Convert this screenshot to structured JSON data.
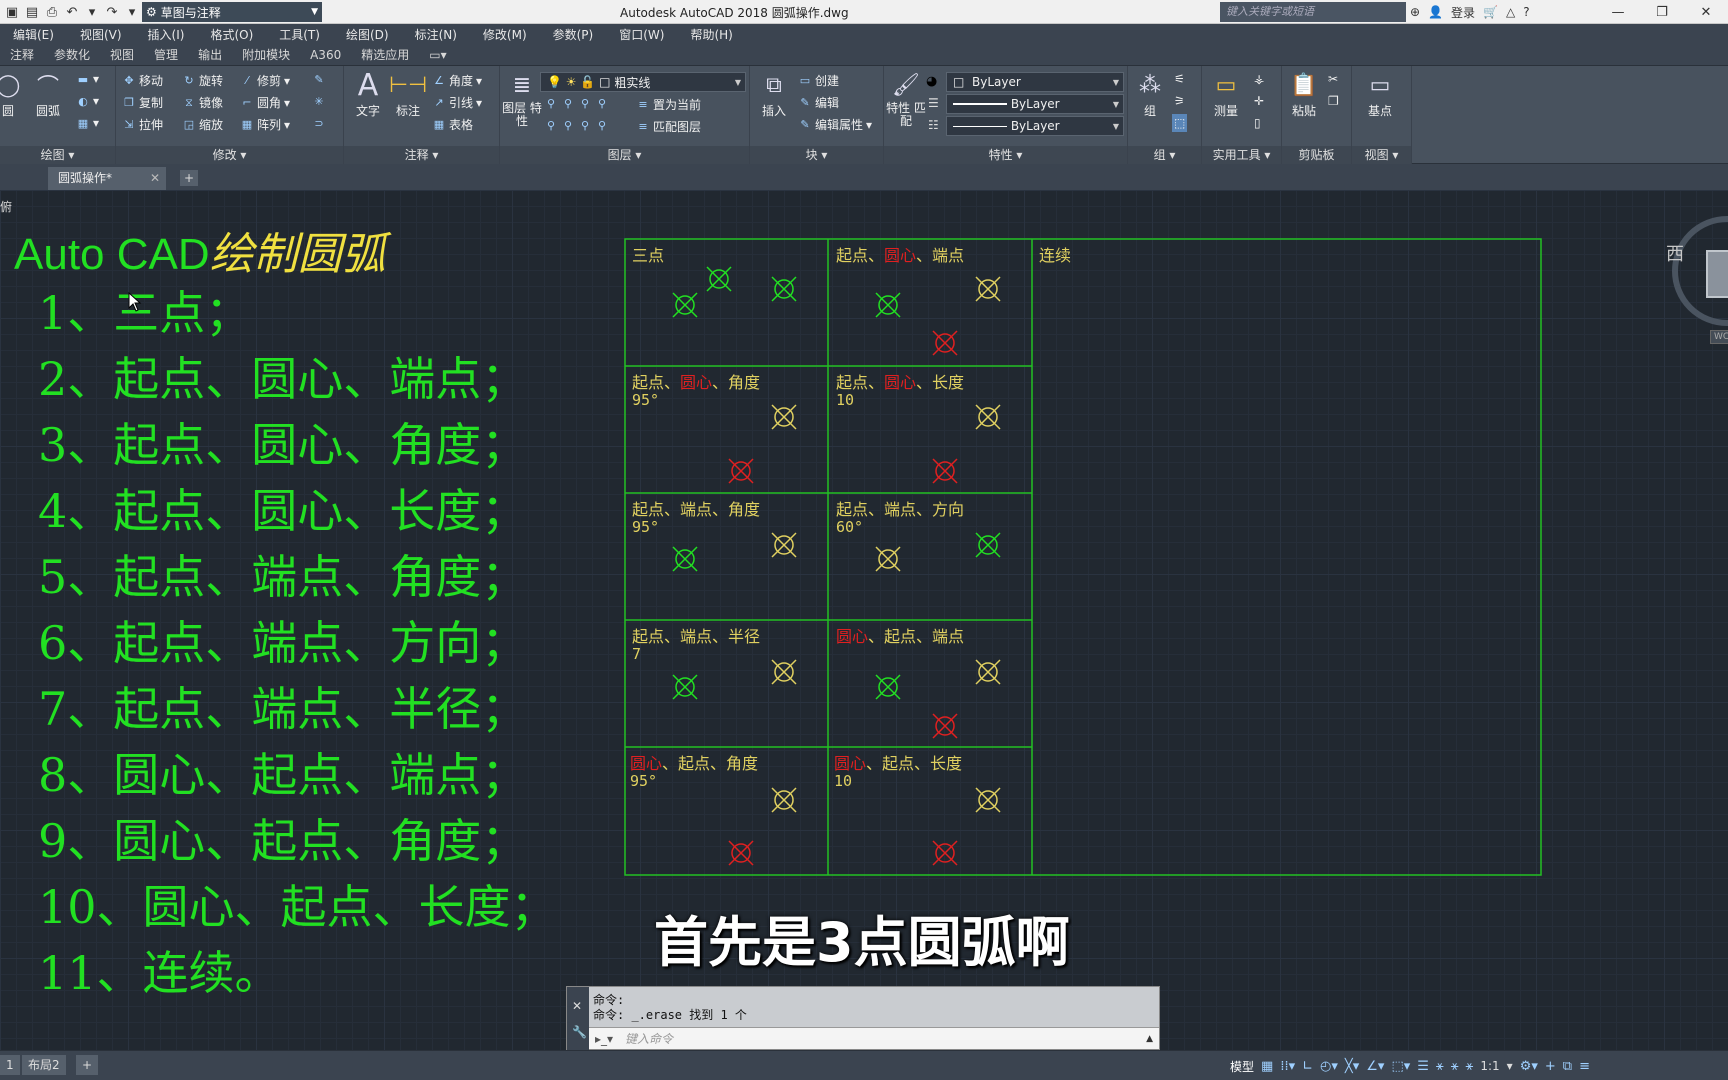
{
  "titlebar": {
    "workspace": "草图与注释",
    "title": "Autodesk AutoCAD 2018    圆弧操作.dwg",
    "search_placeholder": "键入关键字或短语",
    "login": "登录"
  },
  "menu": [
    "编辑(E)",
    "视图(V)",
    "插入(I)",
    "格式(O)",
    "工具(T)",
    "绘图(D)",
    "标注(N)",
    "修改(M)",
    "参数(P)",
    "窗口(W)",
    "帮助(H)"
  ],
  "ribbon_tabs": [
    "注释",
    "参数化",
    "视图",
    "管理",
    "输出",
    "附加模块",
    "A360",
    "精选应用"
  ],
  "ribbon": {
    "draw": {
      "arc": "圆弧",
      "circle": "圆",
      "title": "绘图"
    },
    "modify": {
      "move": "移动",
      "rotate": "旋转",
      "trim": "修剪",
      "copy": "复制",
      "mirror": "镜像",
      "fillet": "圆角",
      "stretch": "拉伸",
      "scale": "缩放",
      "array": "阵列",
      "title": "修改"
    },
    "annotation": {
      "text": "文字",
      "dim": "标注",
      "angle": "角度",
      "leader": "引线",
      "table": "表格",
      "title": "注释"
    },
    "layers": {
      "layer_props": "图层\n特性",
      "current_layer": "粗实线",
      "make_current": "置为当前",
      "match_layer": "匹配图层",
      "title": "图层"
    },
    "block": {
      "insert": "插入",
      "create": "创建",
      "edit": "编辑",
      "edit_attr": "编辑属性",
      "title": "块"
    },
    "properties": {
      "match": "特性\n匹配",
      "color": "ByLayer",
      "linetype": "ByLayer",
      "lineweight": "ByLayer",
      "title": "特性"
    },
    "groups": {
      "group": "组",
      "title": "组"
    },
    "utilities": {
      "measure": "测量",
      "title": "实用工具"
    },
    "clipboard": {
      "paste": "粘贴",
      "title": "剪贴板"
    },
    "view": {
      "base": "基点",
      "title": "视图"
    }
  },
  "doc_tab": "圆弧操作*",
  "viewport_label": "俯",
  "heading": {
    "white": "Auto CAD",
    "yellow": "绘制圆弧"
  },
  "steps": [
    "1、三点；",
    "2、起点、圆心、端点；",
    "3、起点、圆心、角度；",
    "4、起点、圆心、长度；",
    "5、起点、端点、角度；",
    "6、起点、端点、方向；",
    "7、起点、端点、半径；",
    "8、圆心、起点、端点；",
    "9、圆心、起点、角度；",
    "10、圆心、起点、长度；",
    "11、连续。"
  ],
  "cells": [
    {
      "parts": [
        [
          "三点",
          "y"
        ]
      ],
      "value": ""
    },
    {
      "parts": [
        [
          "起点、",
          "y"
        ],
        [
          "圆心",
          "r"
        ],
        [
          "、端点",
          "y"
        ]
      ],
      "value": ""
    },
    {
      "parts": [
        [
          "连续",
          "y"
        ]
      ],
      "value": ""
    },
    {
      "parts": [
        [
          "起点、",
          "y"
        ],
        [
          "圆心",
          "r"
        ],
        [
          "、角度",
          "y"
        ]
      ],
      "value": "95°"
    },
    {
      "parts": [
        [
          "起点、",
          "y"
        ],
        [
          "圆心",
          "r"
        ],
        [
          "、长度",
          "y"
        ]
      ],
      "value": "10"
    },
    {
      "parts": [
        [
          "起点、端点、角度",
          "y"
        ]
      ],
      "value": "95°"
    },
    {
      "parts": [
        [
          "起点、端点、方向",
          "y"
        ]
      ],
      "value": "60°"
    },
    {
      "parts": [
        [
          "起点、端点、半径",
          "y"
        ]
      ],
      "value": "7"
    },
    {
      "parts": [
        [
          "圆心",
          "r"
        ],
        [
          "、起点、端点",
          "y"
        ]
      ],
      "value": ""
    },
    {
      "parts": [
        [
          "圆心",
          "r"
        ],
        [
          "、起点、角度",
          "y"
        ]
      ],
      "value": "95°"
    },
    {
      "parts": [
        [
          "圆心",
          "r"
        ],
        [
          "、起点、长度",
          "y"
        ]
      ],
      "value": "10"
    }
  ],
  "subtitle": "首先是3点圆弧啊",
  "viewcube": {
    "west": "西",
    "wcs": "WCS"
  },
  "command": {
    "line1": "命令:",
    "line2": "命令: _.erase 找到 1 个",
    "placeholder": "键入命令"
  },
  "layout_tabs": [
    "1",
    "布局2"
  ],
  "status": {
    "model": "模型",
    "scale": "1:1"
  },
  "colors": {
    "green": "#22e022",
    "yellow": "#e0d060",
    "red": "#e02020",
    "bg": "#212830"
  }
}
